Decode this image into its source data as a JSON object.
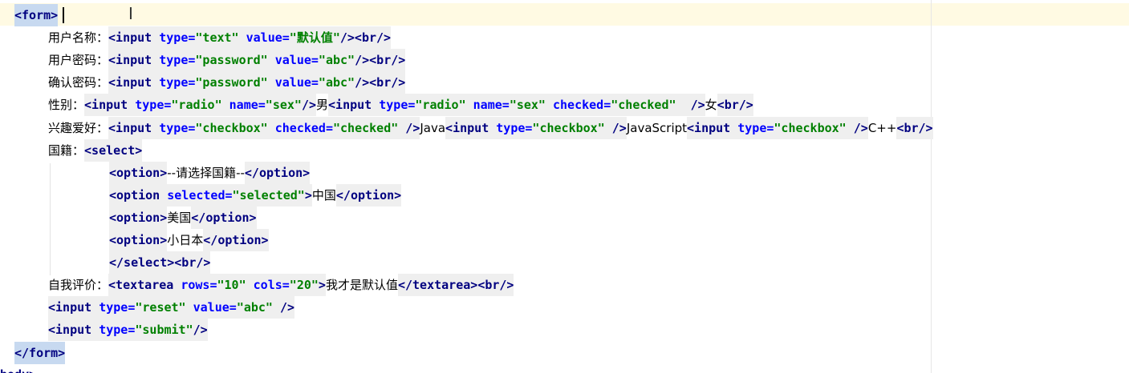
{
  "editor": {
    "language": "html",
    "lines": [
      {
        "indent": 18,
        "tokens": [
          {
            "t": "tag",
            "s": "<form>",
            "hl": "hl"
          }
        ]
      },
      {
        "indent": 60,
        "tokens": [
          {
            "t": "txt",
            "s": "用户名称："
          },
          {
            "t": "tag",
            "s": "<input "
          },
          {
            "t": "attr",
            "s": "type="
          },
          {
            "t": "val",
            "s": "\"text\" "
          },
          {
            "t": "attr",
            "s": "value="
          },
          {
            "t": "val",
            "s": "\"默认值\""
          },
          {
            "t": "tag",
            "s": "/>"
          },
          {
            "t": "tag",
            "s": "<br/>"
          }
        ]
      },
      {
        "indent": 60,
        "tokens": [
          {
            "t": "txt",
            "s": "用户密码："
          },
          {
            "t": "tag",
            "s": "<input "
          },
          {
            "t": "attr",
            "s": "type="
          },
          {
            "t": "val",
            "s": "\"password\" "
          },
          {
            "t": "attr",
            "s": "value="
          },
          {
            "t": "val",
            "s": "\"abc\""
          },
          {
            "t": "tag",
            "s": "/>"
          },
          {
            "t": "tag",
            "s": "<br/>"
          }
        ]
      },
      {
        "indent": 60,
        "tokens": [
          {
            "t": "txt",
            "s": "确认密码："
          },
          {
            "t": "tag",
            "s": "<input "
          },
          {
            "t": "attr",
            "s": "type="
          },
          {
            "t": "val",
            "s": "\"password\" "
          },
          {
            "t": "attr",
            "s": "value="
          },
          {
            "t": "val",
            "s": "\"abc\""
          },
          {
            "t": "tag",
            "s": "/>"
          },
          {
            "t": "tag",
            "s": "<br/>"
          }
        ]
      },
      {
        "indent": 60,
        "tokens": [
          {
            "t": "txt",
            "s": "性别："
          },
          {
            "t": "tag",
            "s": "<input "
          },
          {
            "t": "attr",
            "s": "type="
          },
          {
            "t": "val",
            "s": "\"radio\" "
          },
          {
            "t": "attr",
            "s": "name="
          },
          {
            "t": "val",
            "s": "\"sex\""
          },
          {
            "t": "tag",
            "s": "/>"
          },
          {
            "t": "txt",
            "s": "男"
          },
          {
            "t": "tag",
            "s": "<input "
          },
          {
            "t": "attr",
            "s": "type="
          },
          {
            "t": "val",
            "s": "\"radio\" "
          },
          {
            "t": "attr",
            "s": "name="
          },
          {
            "t": "val",
            "s": "\"sex\" "
          },
          {
            "t": "attr",
            "s": "checked="
          },
          {
            "t": "val",
            "s": "\"checked\"  "
          },
          {
            "t": "tag",
            "s": "/>"
          },
          {
            "t": "txt",
            "s": "女"
          },
          {
            "t": "tag",
            "s": "<br/>"
          }
        ]
      },
      {
        "indent": 60,
        "tokens": [
          {
            "t": "txt",
            "s": "兴趣爱好："
          },
          {
            "t": "tag",
            "s": "<input "
          },
          {
            "t": "attr",
            "s": "type="
          },
          {
            "t": "val",
            "s": "\"checkbox\" "
          },
          {
            "t": "attr",
            "s": "checked="
          },
          {
            "t": "val",
            "s": "\"checked\" "
          },
          {
            "t": "tag",
            "s": "/>"
          },
          {
            "t": "txt",
            "s": "Java"
          },
          {
            "t": "tag",
            "s": "<input "
          },
          {
            "t": "attr",
            "s": "type="
          },
          {
            "t": "val",
            "s": "\"checkbox\" "
          },
          {
            "t": "tag",
            "s": "/>"
          },
          {
            "t": "txt",
            "s": "JavaScript"
          },
          {
            "t": "tag",
            "s": "<input "
          },
          {
            "t": "attr",
            "s": "type="
          },
          {
            "t": "val",
            "s": "\"checkbox\" "
          },
          {
            "t": "tag",
            "s": "/>"
          },
          {
            "t": "txt",
            "s": "C++"
          },
          {
            "t": "tag",
            "s": "<br/>"
          }
        ]
      },
      {
        "indent": 60,
        "tokens": [
          {
            "t": "txt",
            "s": "国籍："
          },
          {
            "t": "tag",
            "s": "<select>"
          }
        ]
      },
      {
        "indent": 136,
        "tokens": [
          {
            "t": "tag",
            "s": "<option>"
          },
          {
            "t": "txt",
            "s": "--请选择国籍--"
          },
          {
            "t": "tag",
            "s": "</option>"
          }
        ]
      },
      {
        "indent": 136,
        "tokens": [
          {
            "t": "tag",
            "s": "<option "
          },
          {
            "t": "attr",
            "s": "selected="
          },
          {
            "t": "val",
            "s": "\"selected\""
          },
          {
            "t": "tag",
            "s": ">"
          },
          {
            "t": "txt",
            "s": "中国"
          },
          {
            "t": "tag",
            "s": "</option>"
          }
        ]
      },
      {
        "indent": 136,
        "tokens": [
          {
            "t": "tag",
            "s": "<option>"
          },
          {
            "t": "txt",
            "s": "美国"
          },
          {
            "t": "tag",
            "s": "</option>"
          }
        ]
      },
      {
        "indent": 136,
        "tokens": [
          {
            "t": "tag",
            "s": "<option>"
          },
          {
            "t": "txt",
            "s": "小日本"
          },
          {
            "t": "tag",
            "s": "</option>"
          }
        ]
      },
      {
        "indent": 136,
        "tokens": [
          {
            "t": "tag",
            "s": "</select>"
          },
          {
            "t": "tag",
            "s": "<br/>"
          }
        ]
      },
      {
        "indent": 60,
        "tokens": [
          {
            "t": "txt",
            "s": "自我评价："
          },
          {
            "t": "tag",
            "s": "<textarea "
          },
          {
            "t": "attr",
            "s": "rows="
          },
          {
            "t": "val",
            "s": "\"10\" "
          },
          {
            "t": "attr",
            "s": "cols="
          },
          {
            "t": "val",
            "s": "\"20\""
          },
          {
            "t": "tag",
            "s": ">"
          },
          {
            "t": "txt",
            "s": "我才是默认值"
          },
          {
            "t": "tag",
            "s": "</textarea>"
          },
          {
            "t": "tag",
            "s": "<br/>"
          }
        ]
      },
      {
        "indent": 60,
        "tokens": [
          {
            "t": "tag",
            "s": "<input "
          },
          {
            "t": "attr",
            "s": "type="
          },
          {
            "t": "val",
            "s": "\"reset\" "
          },
          {
            "t": "attr",
            "s": "value="
          },
          {
            "t": "val",
            "s": "\"abc\" "
          },
          {
            "t": "tag",
            "s": "/>"
          }
        ]
      },
      {
        "indent": 60,
        "tokens": [
          {
            "t": "tag",
            "s": "<input "
          },
          {
            "t": "attr",
            "s": "type="
          },
          {
            "t": "val",
            "s": "\"submit\""
          },
          {
            "t": "tag",
            "s": "/>"
          }
        ]
      },
      {
        "indent": 18,
        "tokens": [
          {
            "t": "tag",
            "s": "</form>",
            "hl": "hl"
          }
        ]
      }
    ],
    "cut_line": "body>"
  }
}
